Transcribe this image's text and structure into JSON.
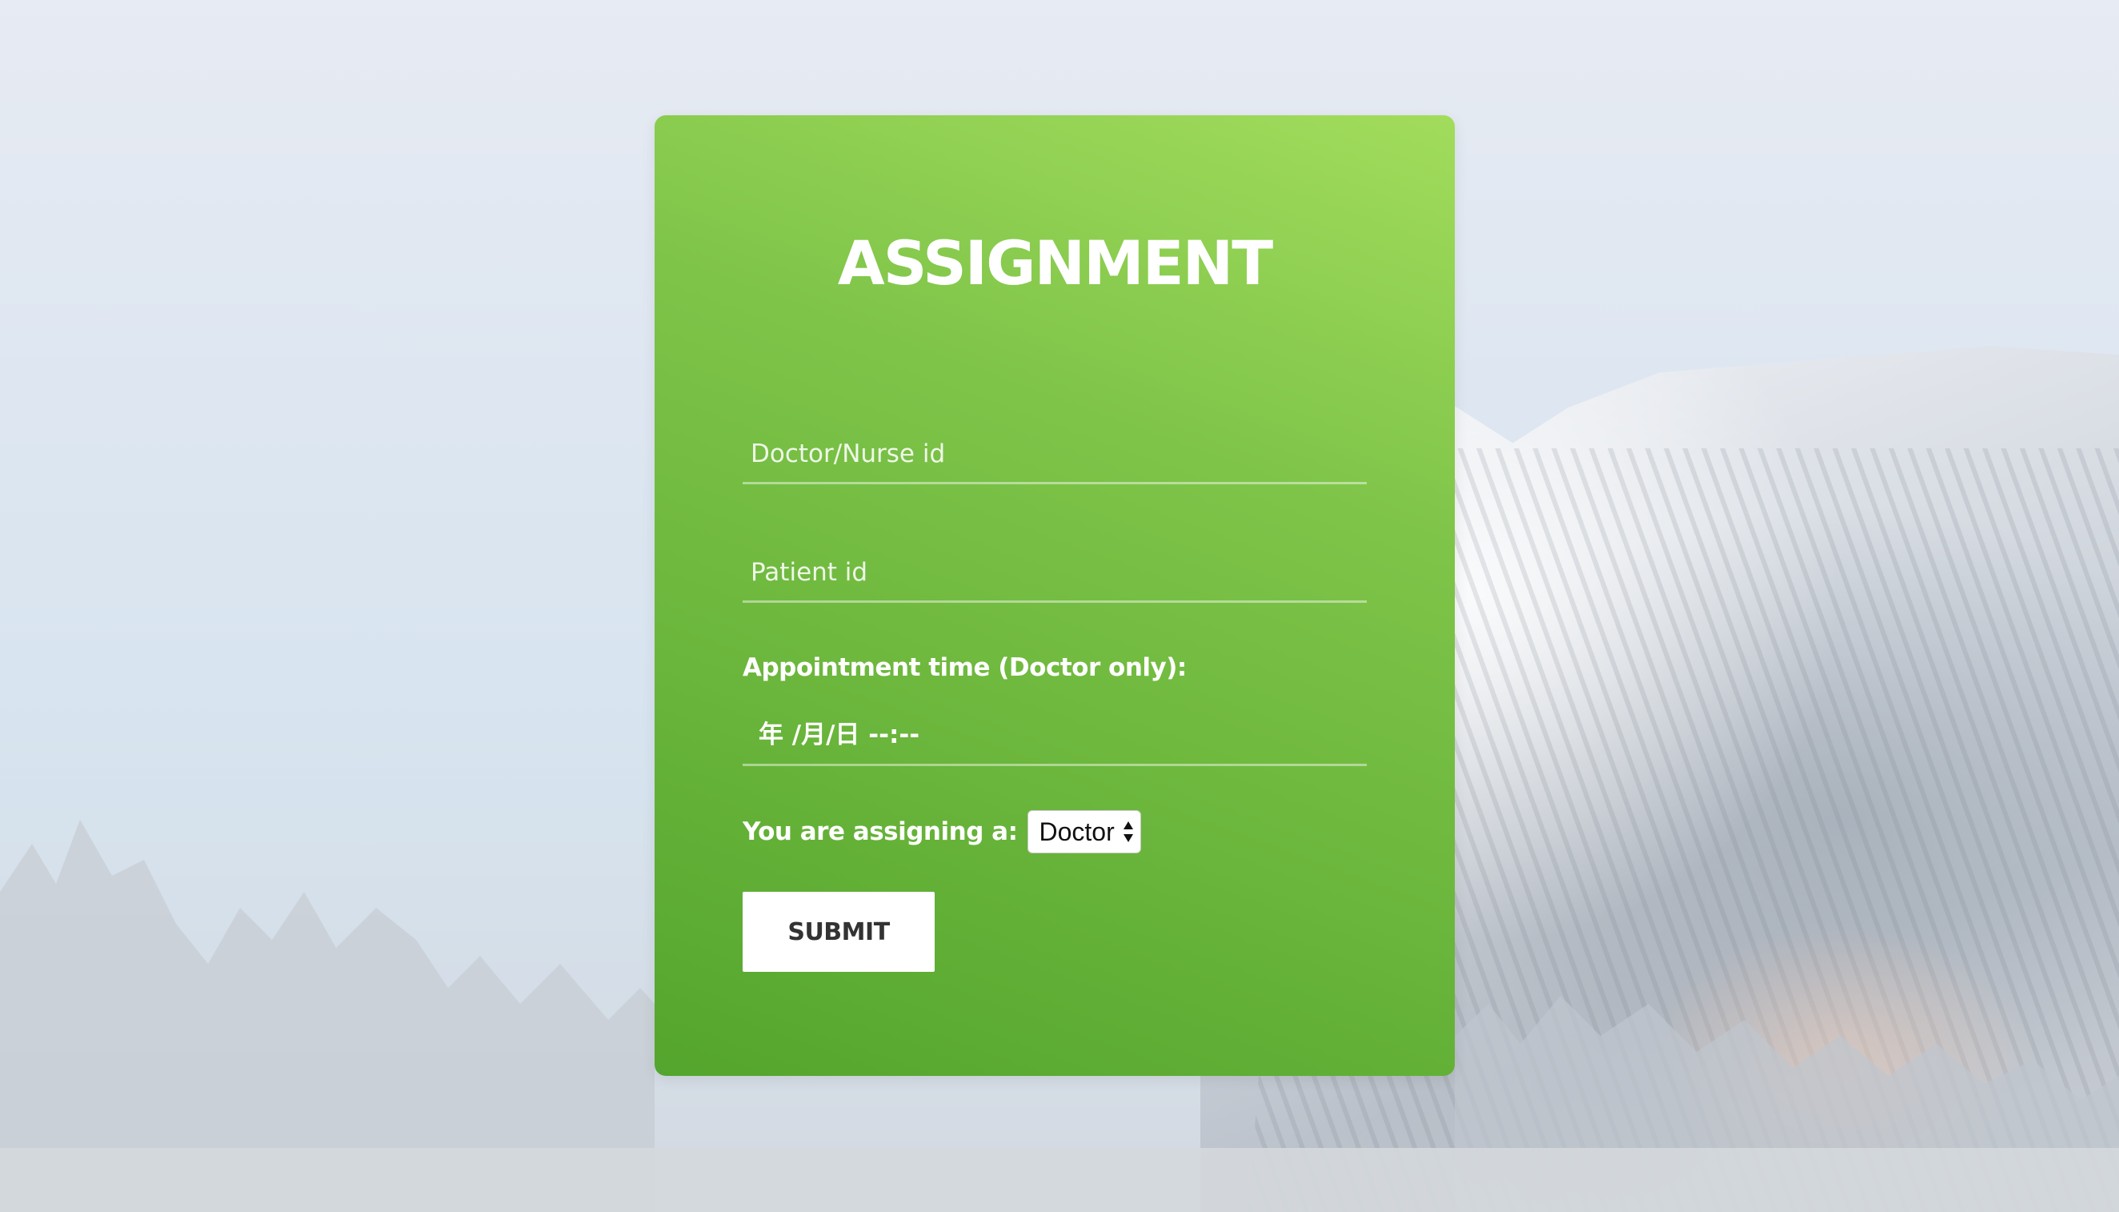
{
  "page": {
    "accent_color": "#7ec449",
    "background_scene": "snowy-mountain-and-trees"
  },
  "form": {
    "title": "ASSIGNMENT",
    "doctor_nurse_field": {
      "placeholder": "Doctor/Nurse id",
      "value": ""
    },
    "patient_field": {
      "placeholder": "Patient id",
      "value": ""
    },
    "appointment_label": "Appointment time (Doctor only):",
    "appointment_value_display": "年 /月/日 --:--",
    "assign_label": "You are assigning a:",
    "assign_select": {
      "selected": "Doctor",
      "icon": "select-arrows-icon"
    },
    "submit_label": "SUBMIT"
  }
}
